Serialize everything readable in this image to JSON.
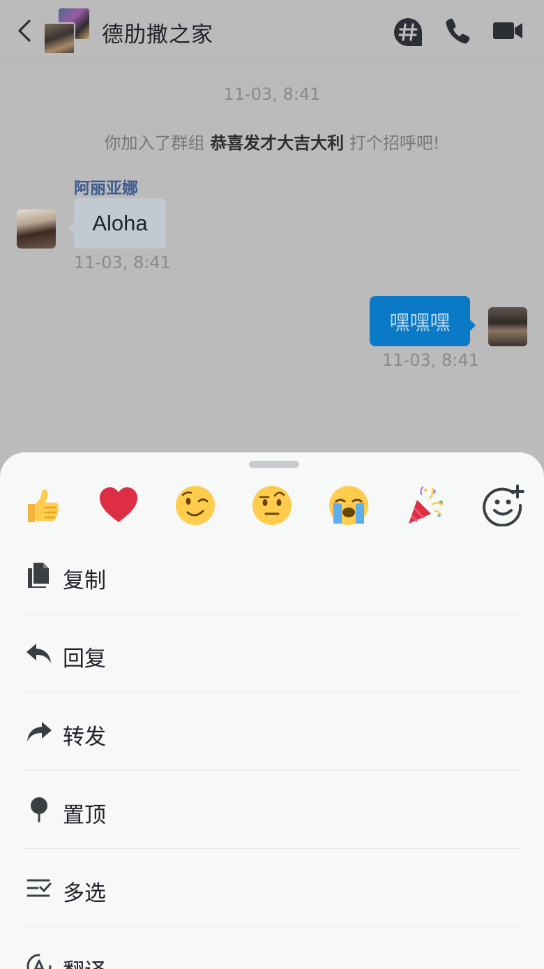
{
  "header": {
    "title": "德肋撒之家"
  },
  "chat": {
    "system_time": "11-03, 8:41",
    "system_message_prefix": "你加入了群组",
    "system_message_group": "恭喜发才大吉大利",
    "system_message_suffix": "打个招呼吧!",
    "messages": [
      {
        "sender": "阿丽亚娜",
        "text": "Aloha",
        "time": "11-03, 8:41",
        "side": "left"
      },
      {
        "sender": "",
        "text": "嘿嘿嘿",
        "time": "11-03, 8:41",
        "side": "right"
      }
    ]
  },
  "reactions": [
    {
      "icon": "thumbs-up-icon"
    },
    {
      "icon": "heart-icon"
    },
    {
      "icon": "wink-face-icon"
    },
    {
      "icon": "raised-eyebrow-face-icon"
    },
    {
      "icon": "crying-face-icon"
    },
    {
      "icon": "party-popper-icon"
    },
    {
      "icon": "add-reaction-icon"
    }
  ],
  "menu": {
    "items": [
      {
        "label": "复制",
        "icon": "copy-icon"
      },
      {
        "label": "回复",
        "icon": "reply-icon"
      },
      {
        "label": "转发",
        "icon": "forward-icon"
      },
      {
        "label": "置顶",
        "icon": "pin-icon"
      },
      {
        "label": "多选",
        "icon": "multi-select-icon"
      },
      {
        "label": "翻译",
        "icon": "translate-icon"
      }
    ]
  },
  "colors": {
    "overlay_background": "#bbbbbb",
    "sent_bubble": "#0a7ac7",
    "received_bubble": "#c2cad1",
    "sender_name": "#3b5a8f",
    "sheet_background": "#f7f8f8"
  }
}
